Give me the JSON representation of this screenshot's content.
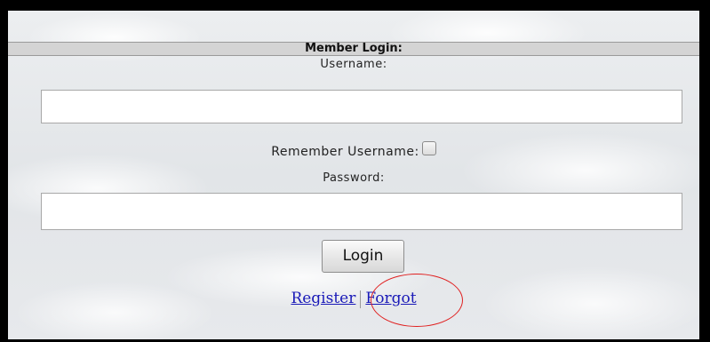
{
  "login_form": {
    "header": "Member Login:",
    "username_label": "Username:",
    "username_value": "",
    "remember_label": "Remember Username:",
    "remember_checked": false,
    "password_label": "Password:",
    "password_value": "",
    "login_button": "Login",
    "register_link": "Register",
    "forgot_link": "Forgot"
  },
  "annotation": {
    "highlight_color": "#e02020",
    "highlighted_element": "forgot-link"
  }
}
